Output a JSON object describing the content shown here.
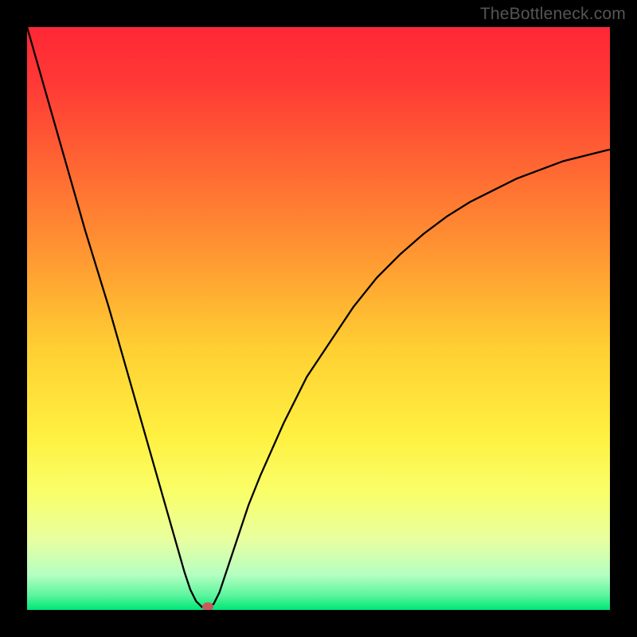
{
  "watermark": "TheBottleneck.com",
  "chart_data": {
    "type": "line",
    "title": "",
    "xlabel": "",
    "ylabel": "",
    "xlim": [
      0,
      100
    ],
    "ylim": [
      0,
      100
    ],
    "x": [
      0,
      2,
      4,
      6,
      8,
      10,
      12,
      14,
      16,
      18,
      20,
      22,
      24,
      26,
      27,
      28,
      29,
      30,
      31,
      32,
      33,
      34,
      36,
      38,
      40,
      44,
      48,
      52,
      56,
      60,
      64,
      68,
      72,
      76,
      80,
      84,
      88,
      92,
      96,
      100
    ],
    "values": [
      100,
      93,
      86,
      79,
      72,
      65,
      58.5,
      52,
      45,
      38,
      31,
      24,
      17,
      10,
      6.5,
      3.5,
      1.5,
      0.5,
      0.5,
      1,
      3,
      6,
      12,
      18,
      23,
      32,
      40,
      46,
      52,
      57,
      61,
      64.5,
      67.5,
      70,
      72,
      74,
      75.5,
      77,
      78,
      79
    ],
    "marker": {
      "x": 31,
      "y": 0.5
    },
    "gradient_stops": [
      {
        "offset": 0.0,
        "color": "#ff2735"
      },
      {
        "offset": 0.1,
        "color": "#ff3a35"
      },
      {
        "offset": 0.25,
        "color": "#ff6a33"
      },
      {
        "offset": 0.4,
        "color": "#ff9a32"
      },
      {
        "offset": 0.55,
        "color": "#ffcf33"
      },
      {
        "offset": 0.7,
        "color": "#fff040"
      },
      {
        "offset": 0.8,
        "color": "#f9ff6a"
      },
      {
        "offset": 0.88,
        "color": "#e8ffa0"
      },
      {
        "offset": 0.94,
        "color": "#b4ffc2"
      },
      {
        "offset": 0.975,
        "color": "#5bf59d"
      },
      {
        "offset": 1.0,
        "color": "#00e676"
      }
    ]
  }
}
